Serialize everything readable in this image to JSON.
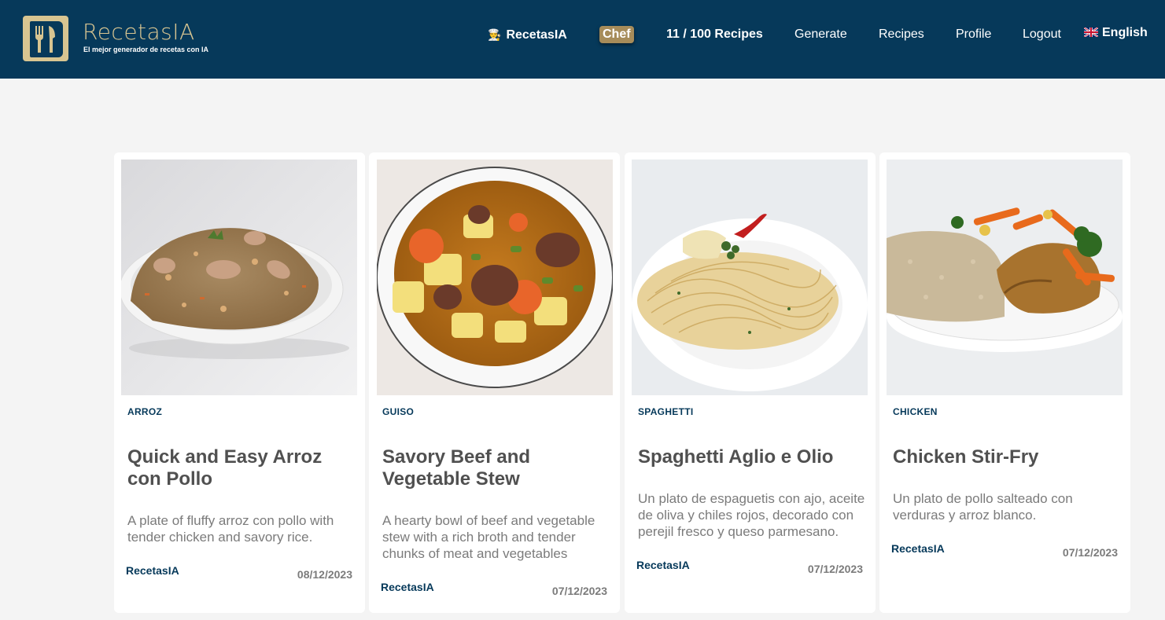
{
  "header": {
    "brand": "RecetasIA",
    "tagline": "El mejor generador de recetas con IA",
    "nav_brand": "RecetasIA",
    "plan_badge": "Chef",
    "recipe_count": "11 / 100 Recipes",
    "generate": "Generate",
    "recipes": "Recipes",
    "profile": "Profile",
    "logout": "Logout",
    "language": "English",
    "icons": {
      "logo": "book-fork-knife-icon",
      "chef": "chef-icon",
      "flag": "uk-flag-icon"
    },
    "colors": {
      "background": "#06395a",
      "accent": "#d8c591",
      "badge": "#a68c5a"
    }
  },
  "cards": [
    {
      "category": "ARROZ",
      "title": "Quick and Easy Arroz con Pollo",
      "description": "A plate of fluffy arroz con pollo with tender chicken and savory rice.",
      "author": "RecetasIA",
      "date": "08/12/2023",
      "image": "arroz-con-pollo-photo"
    },
    {
      "category": "GUISO",
      "title": "Savory Beef and Vegetable Stew",
      "description": "A hearty bowl of beef and vegetable stew with a rich broth and tender chunks of meat and vegetables",
      "author": "RecetasIA",
      "date": "07/12/2023",
      "image": "beef-stew-photo"
    },
    {
      "category": "SPAGHETTI",
      "title": "Spaghetti Aglio e Olio",
      "description": "Un plato de espaguetis con ajo, aceite de oliva y chiles rojos, decorado con perejil fresco y queso parmesano.",
      "author": "RecetasIA",
      "date": "07/12/2023",
      "image": "spaghetti-photo"
    },
    {
      "category": "CHICKEN",
      "title": "Chicken Stir-Fry",
      "description": "Un plato de pollo salteado con verduras y arroz blanco.",
      "author": "RecetasIA",
      "date": "07/12/2023",
      "image": "chicken-stir-fry-photo"
    }
  ]
}
